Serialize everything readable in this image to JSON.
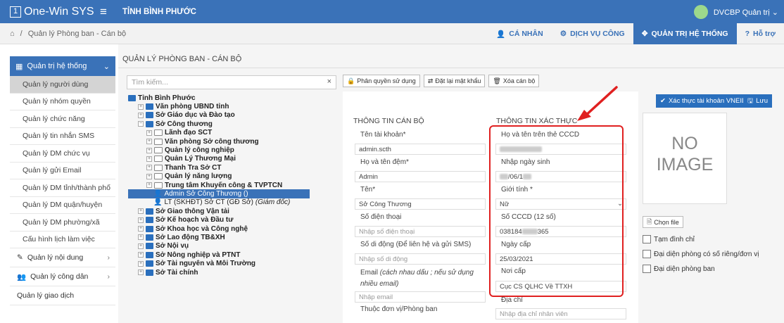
{
  "topbar": {
    "logo_box": "1",
    "app_name": "One-Win SYS",
    "region": "TỈNH BÌNH PHƯỚC",
    "user": "DVCBP Quản trị ⌄"
  },
  "subbar": {
    "breadcrumb": "Quản lý Phòng ban - Cán bộ",
    "links": [
      "CÁ NHÂN",
      "DỊCH VỤ CÔNG",
      "QUẢN TRỊ HỆ THỐNG",
      "Hỗ trợ"
    ]
  },
  "sidebar": {
    "head": "Quản trị hệ thống",
    "items": [
      "Quản lý người dùng",
      "Quản lý nhóm quyền",
      "Quản lý chức năng",
      "Quản lý tin nhắn SMS",
      "Quản lý DM chức vụ",
      "Quản lý gửi Email",
      "Quản lý DM tỉnh/thành phố",
      "Quản lý DM quận/huyện",
      "Quản lý DM phường/xã",
      "Cấu hình lịch làm việc"
    ],
    "groups": [
      "Quản lý nội dung",
      "Quản lý công dân",
      "Quản lý giao dịch"
    ]
  },
  "panel": {
    "title": "QUẢN LÝ PHÒNG BAN - CÁN BỘ",
    "search_placeholder": "Tìm kiếm...",
    "search_clear": "×"
  },
  "tree": {
    "root": "Tỉnh Bình Phước",
    "n1": "Văn phòng UBND tỉnh",
    "n2": "Sở Giáo dục và Đào tạo",
    "n3": "Sở Công thương",
    "c1": "Lãnh đạo SCT",
    "c2": "Văn phòng Sở công thương",
    "c3": "Quản lý công nghiệp",
    "c4": "Quản Lý Thương Mại",
    "c5": "Thanh Tra Sở CT",
    "c6": "Quản lý năng lượng",
    "c7": "Trung tâm Khuyến công & TVPTCN",
    "p1": "Admin Sở Công Thương ()",
    "p2": "LT (SKHĐT) Sở CT (GĐ Sở)",
    "p2_role": "(Giám đốc)",
    "n4": "Sở Giao thông Vận tải",
    "n5": "Sở Kế hoạch và Đầu tư",
    "n6": "Sở Khoa học và Công nghệ",
    "n7": "Sở Lao động TB&XH",
    "n8": "Sở Nội vụ",
    "n9": "Sở Nông nghiệp và PTNT",
    "n10": "Sở Tài nguyên và Môi Trường",
    "n11": "Sở Tài chính"
  },
  "toolbar": {
    "perm": "Phân quyền sử dụng",
    "reset": "Đặt lại mật khẩu",
    "delete": "Xóa cán bộ"
  },
  "form": {
    "sec_left": "THÔNG TIN CÁN BỘ",
    "sec_right": "THÔNG TIN XÁC THỰC",
    "username_label": "Tên tài khoản*",
    "username": "admin.scth",
    "lastname_label": "Họ và tên đệm*",
    "lastname": "Admin",
    "firstname_label": "Tên*",
    "firstname": "Sở Công Thương",
    "phone_label": "Số điện thoại",
    "phone_ph": "Nhập số điện thoại",
    "mobile_label": "Số di động (Để liên hệ và gửi SMS)",
    "mobile_ph": "Nhập số di động",
    "email_label": "Email",
    "email_note": "(cách nhau dấu ; nếu sử dụng nhiều email)",
    "email_ph": "Nhập email",
    "unit_label": "Thuộc đơn vị/Phòng ban",
    "fullname_label": "Họ và tên trên thẻ CCCD",
    "dob_label": "Nhập ngày sinh",
    "dob_suffix": "/06/1",
    "gender_label": "Giới tính *",
    "gender": "Nữ",
    "cccd_label": "Số CCCD (12 số)",
    "cccd_prefix": "038184",
    "cccd_suffix": "365",
    "issue_label": "Ngày cấp",
    "issue_date": "25/03/2021",
    "place_label": "Nơi cấp",
    "place": "Cục CS QLHC Về TTXH",
    "address_label": "Địa chỉ",
    "address_ph": "Nhập địa chỉ nhân viên"
  },
  "right": {
    "vneid": "Xác thực tài khoản VNEID",
    "save": "Lưu",
    "noimage_1": "NO",
    "noimage_2": "IMAGE",
    "choose_file": "Chọn file",
    "cb1": "Tạm đình chỉ",
    "cb2": "Đại diện phòng có số riêng/đơn vị",
    "cb3": "Đại diện phòng ban"
  },
  "colors": {
    "primary": "#3a72b8",
    "highlight": "#e02020",
    "selected_bg": "#d4d4d4"
  }
}
